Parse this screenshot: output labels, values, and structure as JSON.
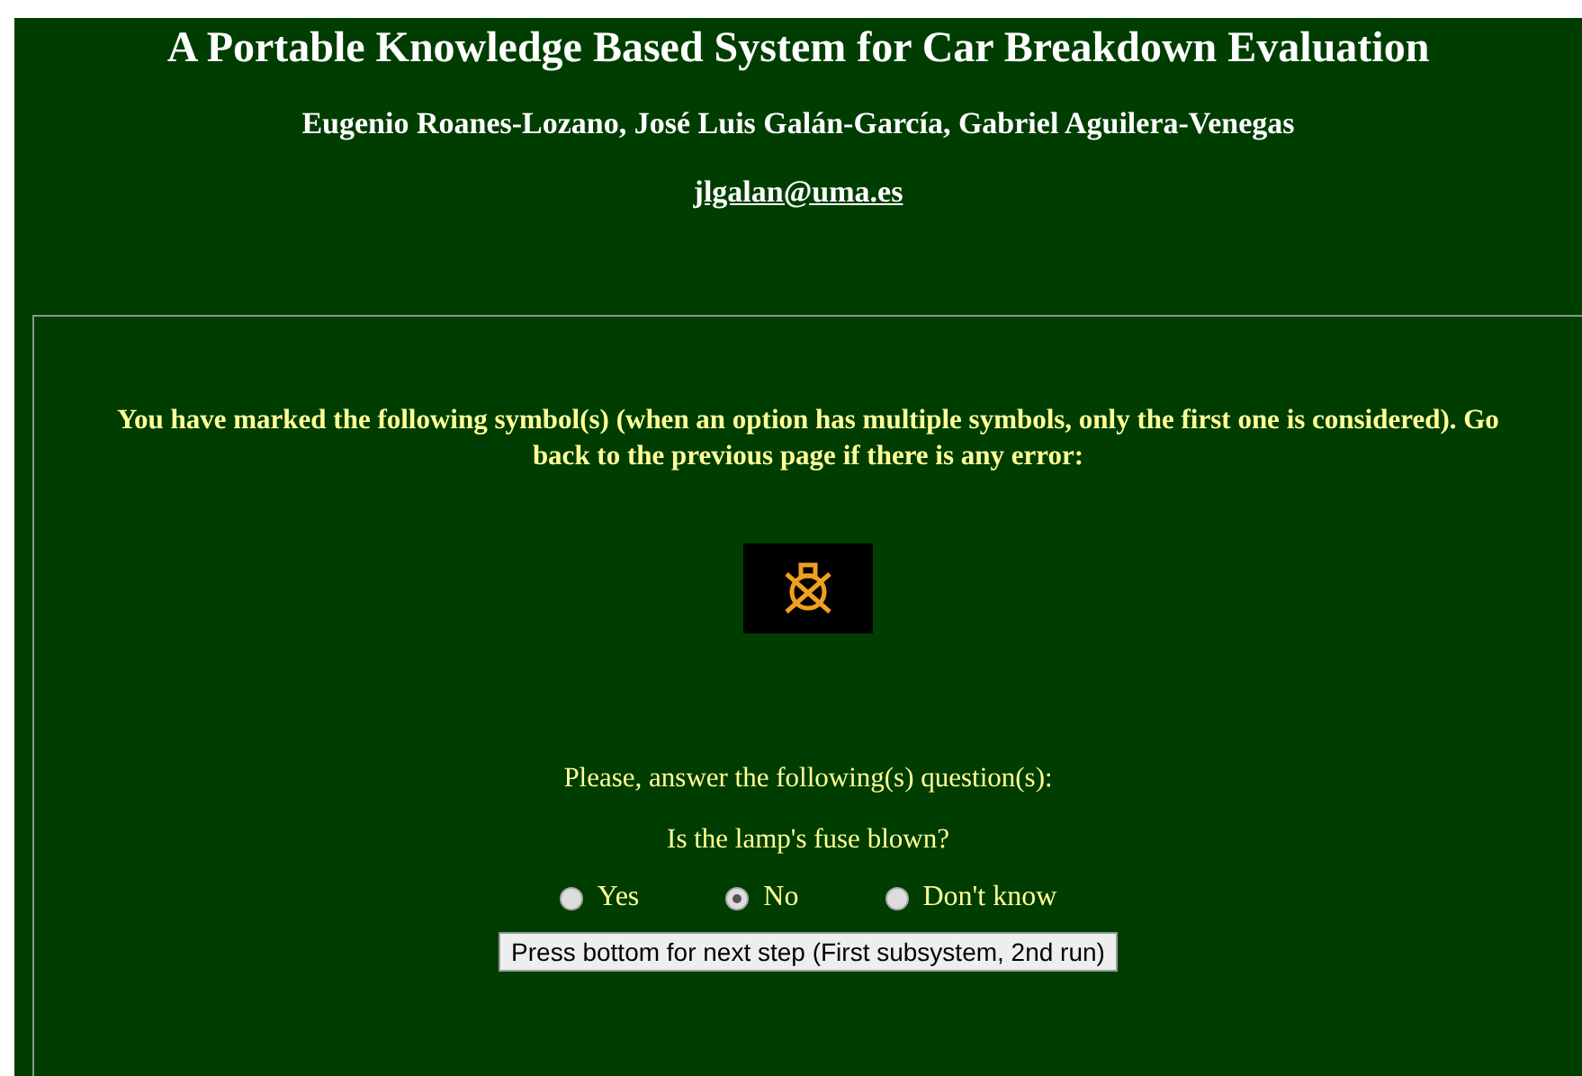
{
  "header": {
    "title": "A Portable Knowledge Based System for Car Breakdown Evaluation",
    "authors": "Eugenio Roanes-Lozano, José Luis Galán-García, Gabriel Aguilera-Venegas",
    "email": "jlgalan@uma.es"
  },
  "panel": {
    "notice": "You have marked the following symbol(s) (when an option has multiple symbols, only the first one is considered). Go back to the previous page if there is any error:",
    "prompt": "Please, answer the following(s) question(s):",
    "question": "Is the lamp's fuse blown?",
    "options": [
      {
        "label": "Yes",
        "selected": false
      },
      {
        "label": "No",
        "selected": true
      },
      {
        "label": "Don't know",
        "selected": false
      }
    ],
    "button": "Press bottom for next step (First subsystem, 2nd run)"
  }
}
